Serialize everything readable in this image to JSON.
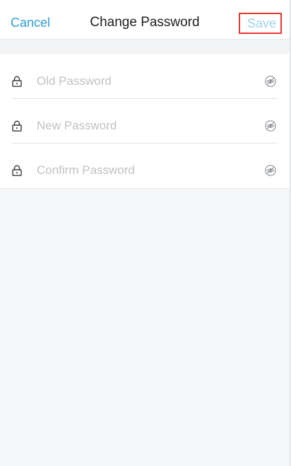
{
  "nav": {
    "cancel_label": "Cancel",
    "title": "Change Password",
    "save_label": "Save"
  },
  "fields": [
    {
      "placeholder": "Old Password",
      "icon": "lock-icon",
      "toggle_icon": "eye-hidden-icon"
    },
    {
      "placeholder": "New Password",
      "icon": "lock-icon",
      "toggle_icon": "eye-hidden-icon"
    },
    {
      "placeholder": "Confirm Password",
      "icon": "lock-icon",
      "toggle_icon": "eye-hidden-icon"
    }
  ],
  "colors": {
    "accent": "#2f9ed3",
    "save_disabled": "#9fd2ef",
    "highlight_border": "#e33a32",
    "background": "#f5f6f8"
  }
}
